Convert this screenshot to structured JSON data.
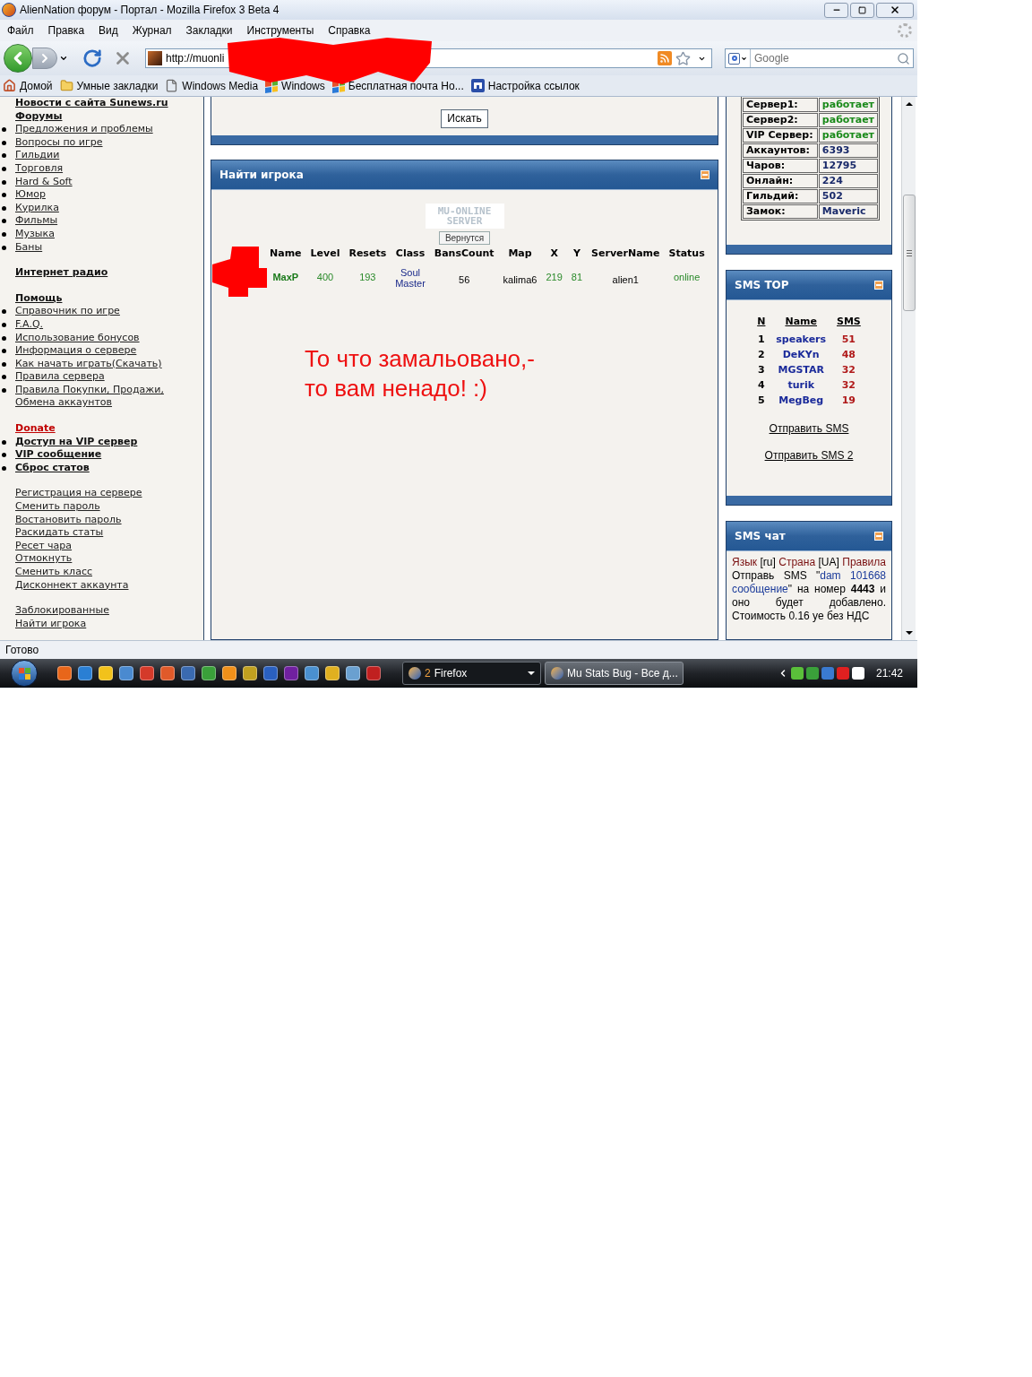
{
  "window": {
    "title": "AlienNation форум - Портал - Mozilla Firefox 3 Beta 4"
  },
  "menu": [
    "Файл",
    "Правка",
    "Вид",
    "Журнал",
    "Закладки",
    "Инструменты",
    "Справка"
  ],
  "address_bar": {
    "value": "http://muonli"
  },
  "search_box": {
    "placeholder": "Google"
  },
  "bookmarks": [
    {
      "label": "Домой",
      "kind": "home"
    },
    {
      "label": "Умные закладки",
      "kind": "folder"
    },
    {
      "label": "Windows Media",
      "kind": "page"
    },
    {
      "label": "Windows",
      "kind": "windows"
    },
    {
      "label": "Бесплатная почта Но...",
      "kind": "windows"
    },
    {
      "label": "Настройка ссылок",
      "kind": "m"
    }
  ],
  "sidebar": {
    "sections": [
      {
        "items": [
          {
            "label": "Новости с сайта Sunews.ru",
            "kind": "heading"
          },
          {
            "label": "Форумы",
            "kind": "heading"
          },
          {
            "label": "Предложения и проблемы",
            "kind": "bullet"
          },
          {
            "label": "Вопросы по игре",
            "kind": "bullet"
          },
          {
            "label": "Гильдии",
            "kind": "bullet"
          },
          {
            "label": "Торговля",
            "kind": "bullet"
          },
          {
            "label": "Hard & Soft",
            "kind": "bullet"
          },
          {
            "label": "Юмор",
            "kind": "bullet"
          },
          {
            "label": "Курилка",
            "kind": "bullet"
          },
          {
            "label": "Фильмы",
            "kind": "bullet"
          },
          {
            "label": "Музыка",
            "kind": "bullet"
          },
          {
            "label": "Баны",
            "kind": "bullet"
          }
        ]
      },
      {
        "items": [
          {
            "label": "Интернет радио",
            "kind": "heading"
          }
        ]
      },
      {
        "items": [
          {
            "label": "Помощь",
            "kind": "heading"
          },
          {
            "label": "Справочник по игре",
            "kind": "bullet"
          },
          {
            "label": "F.A.Q.",
            "kind": "bullet"
          },
          {
            "label": "Использование бонусов",
            "kind": "bullet"
          },
          {
            "label": "Информация о сервере",
            "kind": "bullet"
          },
          {
            "label": "Как начать играть(Скачать)",
            "kind": "bullet"
          },
          {
            "label": "Правила сервера",
            "kind": "bullet"
          },
          {
            "label": "Правила Покупки, Продажи, Обмена аккаунтов",
            "kind": "bullet"
          }
        ]
      },
      {
        "items": [
          {
            "label": "Donate",
            "kind": "donate"
          },
          {
            "label": "Доступ на VIP сервер",
            "kind": "bold_bullet"
          },
          {
            "label": "VIP сообщение",
            "kind": "bold_bullet"
          },
          {
            "label": "Сброс статов",
            "kind": "bold_bullet"
          }
        ]
      },
      {
        "items": [
          {
            "label": "Регистрация на сервере",
            "kind": "link"
          },
          {
            "label": "Сменить пароль",
            "kind": "link"
          },
          {
            "label": "Востановить пароль",
            "kind": "link"
          },
          {
            "label": "Раскидать статы",
            "kind": "link"
          },
          {
            "label": "Ресет чара",
            "kind": "link"
          },
          {
            "label": "Отмокнуть",
            "kind": "link"
          },
          {
            "label": "Сменить класс",
            "kind": "link"
          },
          {
            "label": "Дисконнект аккаунта",
            "kind": "link"
          }
        ]
      },
      {
        "items": [
          {
            "label": "Заблокированные",
            "kind": "link"
          },
          {
            "label": "Найти игрока",
            "kind": "link"
          }
        ]
      }
    ]
  },
  "search_panel": {
    "button": "Искать"
  },
  "player_panel": {
    "title": "Найти игрока",
    "logo": [
      "MU-ONLINE",
      "SERVER"
    ],
    "back_button": "Вернутся",
    "table": {
      "columns": [
        {
          "label": "Name",
          "kind": "name"
        },
        {
          "label": "Level",
          "kind": "number"
        },
        {
          "label": "Resets",
          "kind": "number"
        },
        {
          "label": "Class",
          "kind": "class"
        },
        {
          "label": "BansCount",
          "kind": "plain"
        },
        {
          "label": "Map",
          "kind": "plain"
        },
        {
          "label": "X",
          "kind": "number"
        },
        {
          "label": "Y",
          "kind": "number"
        },
        {
          "label": "ServerName",
          "kind": "plain"
        },
        {
          "label": "Status",
          "kind": "number"
        }
      ],
      "rows": [
        [
          "MaxP",
          "400",
          "193",
          "Soul Master",
          "56",
          "kalima6",
          "219",
          "81",
          "alien1",
          "online"
        ]
      ]
    }
  },
  "annotation": {
    "lines": [
      "То что замальовано,-",
      "то вам ненадо! :)"
    ]
  },
  "server_status": {
    "rows": [
      {
        "label": "Сервер1:",
        "value": "работает",
        "kind": "status"
      },
      {
        "label": "Сервер2:",
        "value": "работает",
        "kind": "status"
      },
      {
        "label": "VIP Сервер:",
        "value": "работает",
        "kind": "status"
      },
      {
        "label": "Аккаунтов:",
        "value": "6393",
        "kind": "value"
      },
      {
        "label": "Чаров:",
        "value": "12795",
        "kind": "value"
      },
      {
        "label": "Онлайн:",
        "value": "224",
        "kind": "value"
      },
      {
        "label": "Гильдий:",
        "value": "502",
        "kind": "value"
      },
      {
        "label": "Замок:",
        "value": "Maveric",
        "kind": "value"
      }
    ]
  },
  "sms_top": {
    "title": "SMS TOP",
    "columns": [
      "N",
      "Name",
      "SMS"
    ],
    "rows": [
      {
        "n": "1",
        "name": "speakers",
        "sms": "51"
      },
      {
        "n": "2",
        "name": "DeKYn",
        "sms": "48"
      },
      {
        "n": "3",
        "name": "MGSTAR",
        "sms": "32"
      },
      {
        "n": "4",
        "name": "turik",
        "sms": "32"
      },
      {
        "n": "5",
        "name": "MegBeg",
        "sms": "19"
      }
    ],
    "links": [
      "Отправить SMS",
      "Отправить SMS 2"
    ]
  },
  "sms_chat": {
    "title": "SMS чат",
    "segments": [
      {
        "text": "Язык",
        "kind": "label"
      },
      {
        "text": " [ru] ",
        "kind": "plain"
      },
      {
        "text": "Страна",
        "kind": "label"
      },
      {
        "text": " [UA] ",
        "kind": "plain"
      },
      {
        "text": "Правила",
        "kind": "label"
      },
      {
        "text": " Отправь SMS \"",
        "kind": "plain"
      },
      {
        "text": "dam 101668 сообщение",
        "kind": "code"
      },
      {
        "text": "\" на номер ",
        "kind": "plain"
      },
      {
        "text": "4443",
        "kind": "bold"
      },
      {
        "text": " и оно будет добавлено. Стоимость 0.16 уе без НДС",
        "kind": "plain"
      }
    ]
  },
  "status_bar": {
    "text": "Готово"
  },
  "taskbar": {
    "tasks": [
      {
        "count": "2",
        "label": "Firefox",
        "selected": true
      },
      {
        "label": "Mu Stats Bug - Все д...",
        "selected": false
      }
    ],
    "clock": "21:42"
  }
}
